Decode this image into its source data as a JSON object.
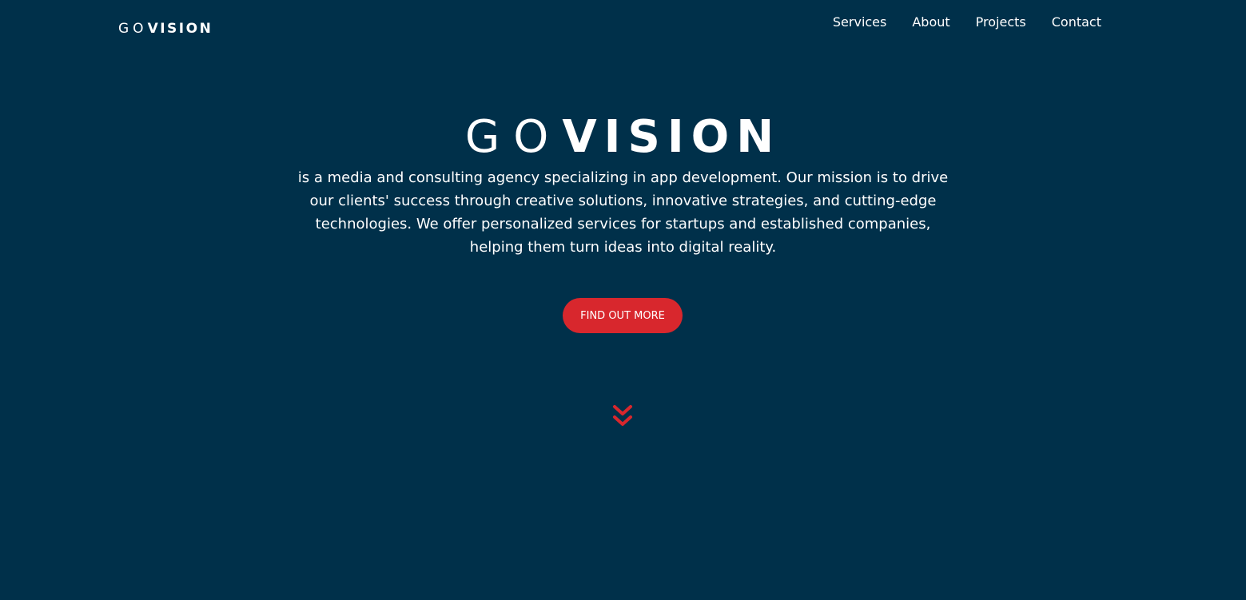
{
  "brand": {
    "light": "GO",
    "bold": "VISION"
  },
  "nav": {
    "items": [
      {
        "label": "Services"
      },
      {
        "label": "About"
      },
      {
        "label": "Projects"
      },
      {
        "label": "Contact"
      }
    ]
  },
  "hero": {
    "title_light": "GO",
    "title_bold": "VISION",
    "description": "is a media and consulting agency specializing in app development. Our mission is to drive our clients' success through creative solutions, innovative strategies, and cutting-edge technologies. We offer personalized services for startups and established companies, helping them turn ideas into digital reality.",
    "cta_label": "FIND OUT MORE"
  },
  "icons": {
    "scroll": "double-chevron-down-icon"
  },
  "colors": {
    "background": "#00304a",
    "accent": "#d8272d",
    "text": "#ffffff"
  }
}
